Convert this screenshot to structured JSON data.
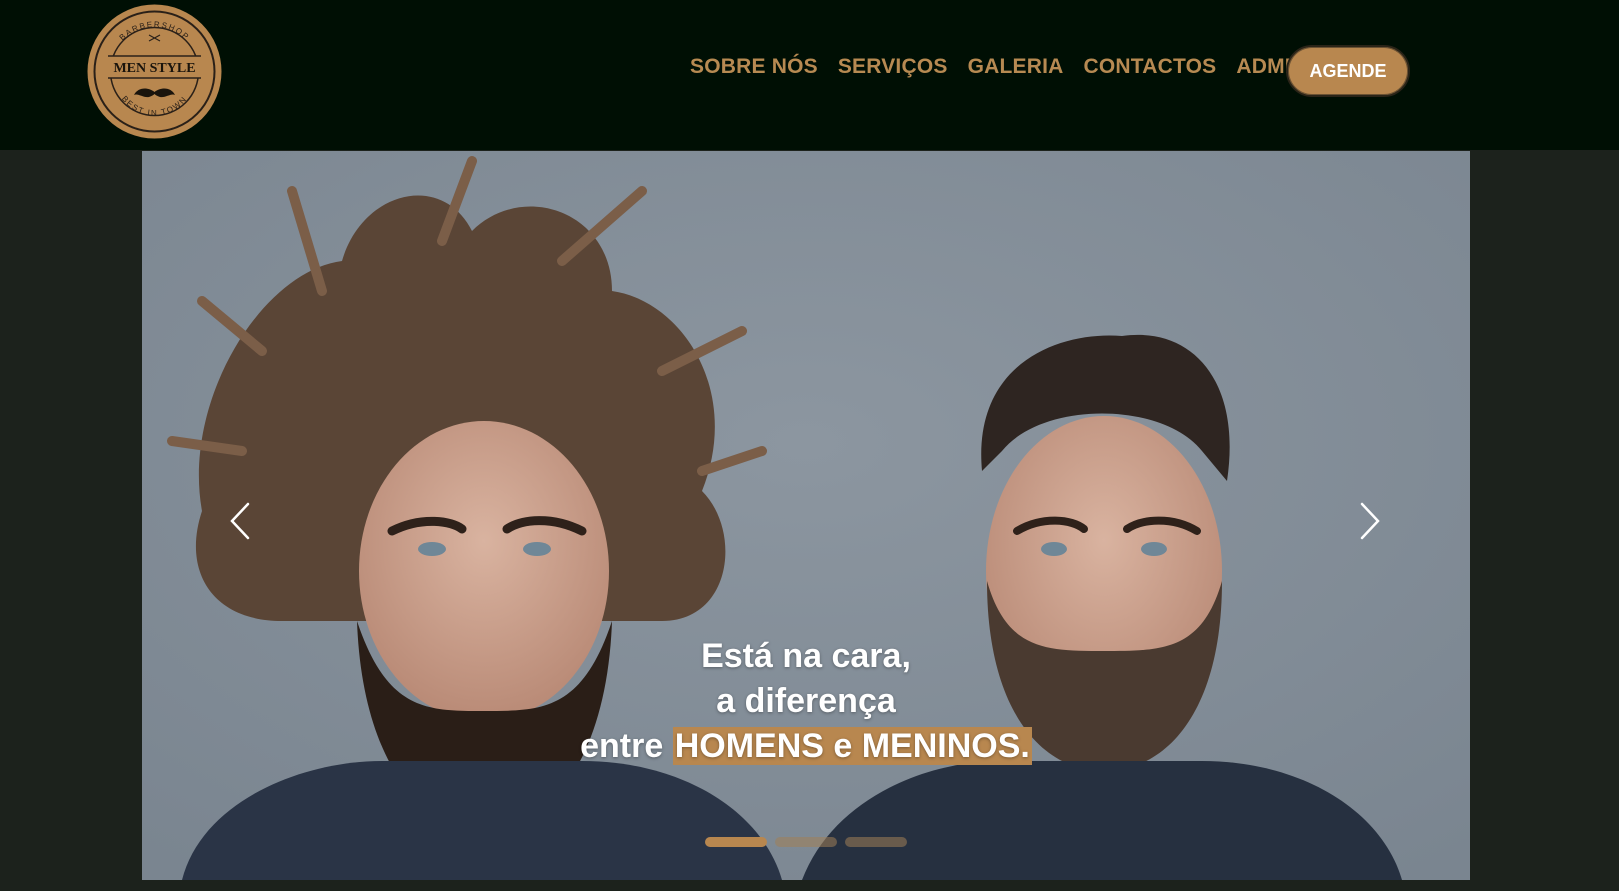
{
  "brand": {
    "logo_top_text": "BARBERSHOP",
    "logo_name": "MEN STYLE",
    "logo_bottom_text": "BEST IN TOWN"
  },
  "nav": {
    "items": [
      {
        "label": "SOBRE NÓS"
      },
      {
        "label": "SERVIÇOS"
      },
      {
        "label": "GALERIA"
      },
      {
        "label": "CONTACTOS"
      },
      {
        "label": "ADMIN"
      }
    ],
    "cta_label": "AGENDE"
  },
  "hero": {
    "line1": "Está na cara,",
    "line2": "a diferença",
    "line3_prefix": "entre",
    "line3_highlight": "HOMENS e MENINOS.",
    "slide_count": 3,
    "active_slide": 1
  },
  "colors": {
    "navbar_bg": "#000f04",
    "accent": "#b8874f",
    "page_bg": "#1c221c"
  }
}
